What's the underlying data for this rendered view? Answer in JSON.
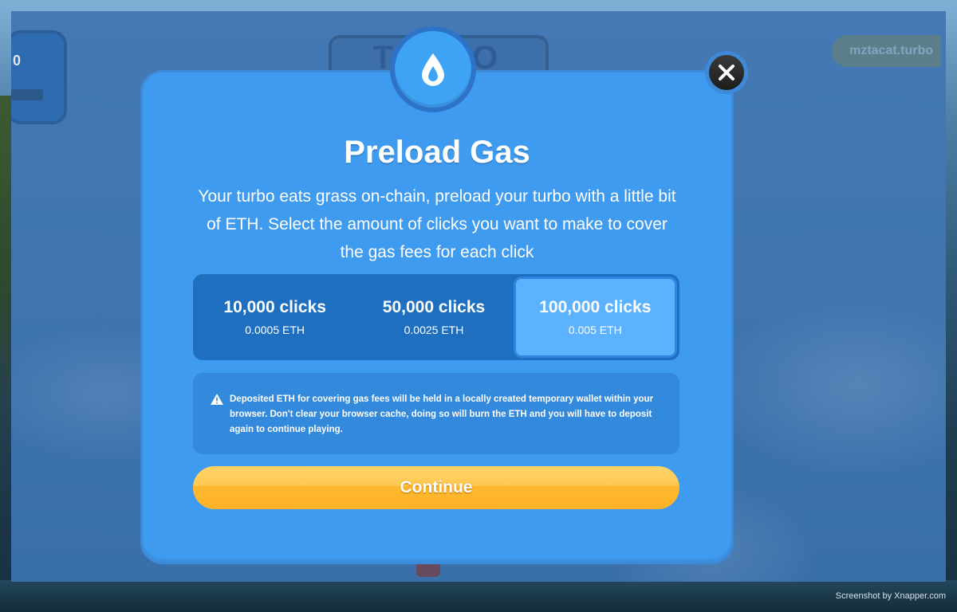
{
  "game": {
    "score_value": "0",
    "logo_text": "TURBO TAP",
    "username": "mztacat.turbo"
  },
  "modal": {
    "icon": "water-drop-icon",
    "close_icon": "close-icon",
    "title": "Preload Gas",
    "description": "Your turbo eats grass on-chain, preload your turbo with a little bit of ETH. Select the amount of clicks you want to make to cover the gas fees for each click",
    "options": [
      {
        "label": "10,000 clicks",
        "price": "0.0005 ETH",
        "selected": false
      },
      {
        "label": "50,000 clicks",
        "price": "0.0025 ETH",
        "selected": false
      },
      {
        "label": "100,000 clicks",
        "price": "0.005 ETH",
        "selected": true
      }
    ],
    "notice_icon": "warning-icon",
    "notice": "Deposited ETH for covering gas fees will be held in a locally created temporary wallet within your browser. Don't clear your browser cache, doing so will burn the ETH and you will have to deposit again to continue playing.",
    "continue_label": "Continue"
  },
  "watermark": "Screenshot by Xnapper.com",
  "colors": {
    "modal_bg": "#3f9bf0",
    "options_bg": "#1f6fc0",
    "selected_option_bg": "#5cb2ff",
    "continue_button": "#ffc34a"
  }
}
